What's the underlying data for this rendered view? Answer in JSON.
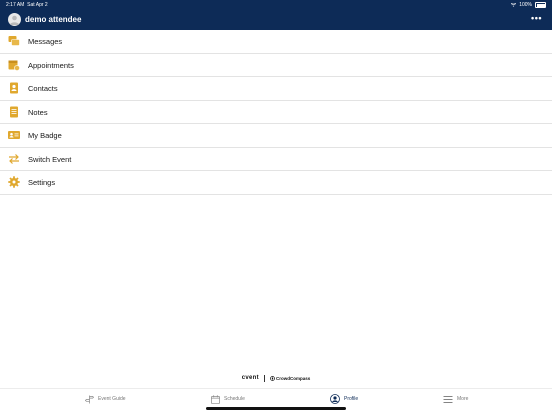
{
  "status_bar": {
    "time": "2:17 AM",
    "date": "Sat Apr 2",
    "battery": "100%"
  },
  "header": {
    "title": "demo attendee",
    "more_label": "•••"
  },
  "menu": [
    {
      "label": "Messages",
      "icon": "messages-icon"
    },
    {
      "label": "Appointments",
      "icon": "appointments-icon"
    },
    {
      "label": "Contacts",
      "icon": "contacts-icon"
    },
    {
      "label": "Notes",
      "icon": "notes-icon"
    },
    {
      "label": "My Badge",
      "icon": "badge-icon"
    },
    {
      "label": "Switch Event",
      "icon": "switch-event-icon"
    },
    {
      "label": "Settings",
      "icon": "settings-icon"
    }
  ],
  "brand": {
    "primary": "cvent",
    "secondary": "CrowdCompass"
  },
  "tabs": [
    {
      "label": "Event Guide",
      "icon": "event-guide-icon",
      "active": false
    },
    {
      "label": "Schedule",
      "icon": "calendar-icon",
      "active": false
    },
    {
      "label": "Profile",
      "icon": "profile-icon",
      "active": true
    },
    {
      "label": "More",
      "icon": "menu-icon",
      "active": false
    }
  ],
  "colors": {
    "header": "#0d2b57",
    "icon_accent": "#e0a82e",
    "active_tab": "#0d2b57"
  }
}
